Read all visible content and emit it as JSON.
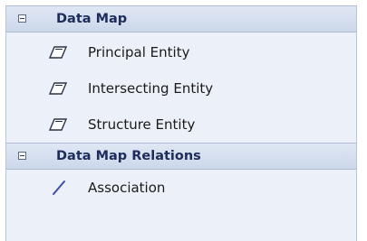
{
  "groups": [
    {
      "title": "Data Map",
      "items": [
        {
          "label": "Principal Entity",
          "icon": "entity-icon"
        },
        {
          "label": "Intersecting Entity",
          "icon": "entity-icon"
        },
        {
          "label": "Structure Entity",
          "icon": "entity-icon"
        }
      ]
    },
    {
      "title": "Data Map Relations",
      "items": [
        {
          "label": "Association",
          "icon": "association-icon"
        }
      ]
    }
  ]
}
